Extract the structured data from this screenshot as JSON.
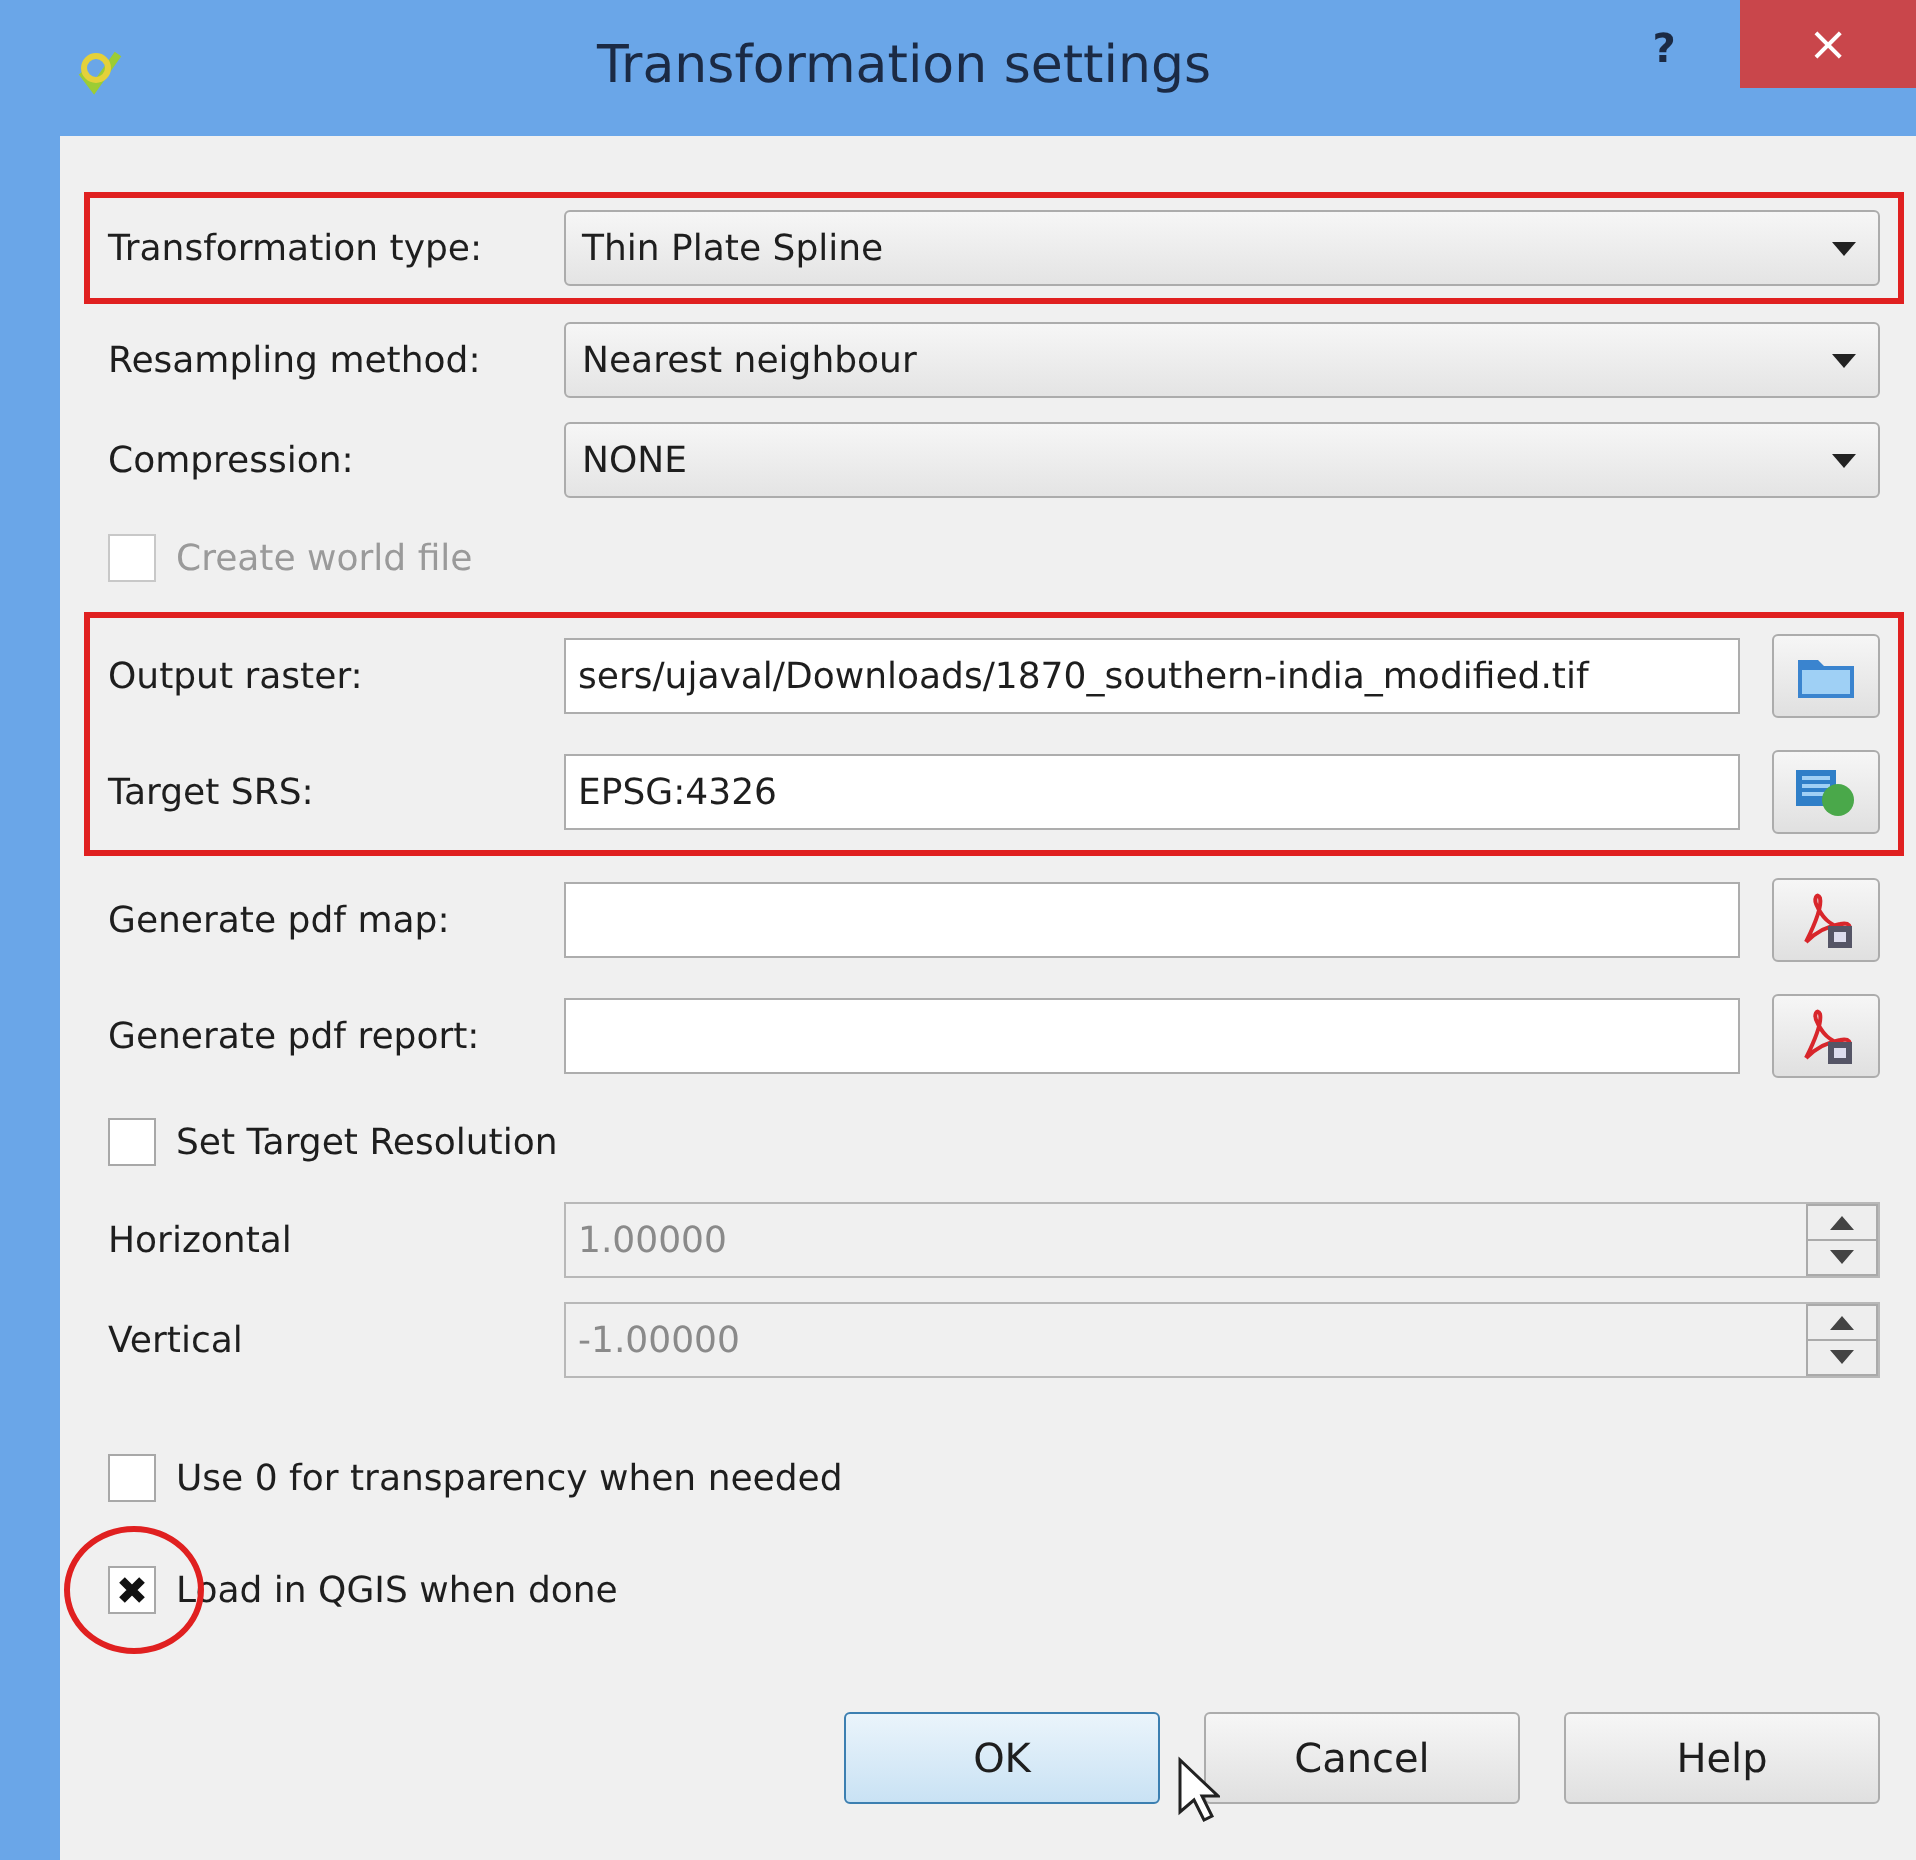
{
  "window": {
    "title": "Transformation settings",
    "help_button": "?",
    "close_button": "×"
  },
  "groups": [
    {
      "highlighted": true,
      "rows": [
        {
          "kind": "combo",
          "label": "Transformation type:",
          "value": "Thin Plate Spline"
        }
      ]
    },
    {
      "highlighted": false,
      "rows": [
        {
          "kind": "combo",
          "label": "Resampling method:",
          "value": "Nearest neighbour"
        },
        {
          "kind": "combo",
          "label": "Compression:",
          "value": "NONE"
        },
        {
          "kind": "checkbox",
          "label": "Create world file",
          "checked": false,
          "disabled": true,
          "circled": false
        }
      ]
    },
    {
      "highlighted": true,
      "rows": [
        {
          "kind": "file",
          "label": "Output raster:",
          "value": "sers/ujaval/Downloads/1870_southern-india_modified.tif"
        },
        {
          "kind": "file",
          "label": "Target SRS:",
          "value": "EPSG:4326"
        }
      ]
    },
    {
      "highlighted": false,
      "rows": [
        {
          "kind": "file",
          "label": "Generate pdf map:"
        },
        {
          "kind": "file",
          "label": "Generate pdf report:"
        },
        {
          "kind": "checkbox",
          "label": "Set Target Resolution",
          "checked": false,
          "disabled": false,
          "circled": false
        },
        {
          "kind": "spin",
          "label": "Horizontal",
          "value": "1.00000",
          "disabled": true
        },
        {
          "kind": "spin",
          "label": "Vertical",
          "value": "-1.00000",
          "disabled": true
        },
        {
          "kind": "spacer"
        },
        {
          "kind": "checkbox",
          "label": "Use 0 for transparency when needed",
          "checked": false,
          "disabled": false,
          "circled": false
        },
        {
          "kind": "checkbox",
          "label": "Load in QGIS when done",
          "checked": true,
          "disabled": false,
          "circled": true
        }
      ]
    }
  ],
  "buttons": [
    {
      "label": "OK",
      "default": true
    },
    {
      "label": "Cancel",
      "default": false
    },
    {
      "label": "Help",
      "default": false
    }
  ]
}
